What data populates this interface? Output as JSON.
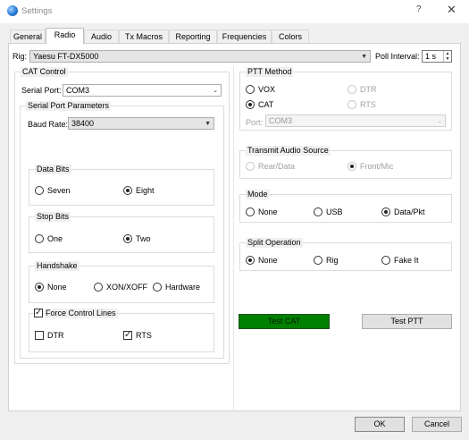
{
  "window": {
    "title": "Settings",
    "help_glyph": "?",
    "close_glyph": "✕"
  },
  "tabs": [
    {
      "label": "General"
    },
    {
      "label": "Radio"
    },
    {
      "label": "Audio"
    },
    {
      "label": "Tx Macros"
    },
    {
      "label": "Reporting"
    },
    {
      "label": "Frequencies"
    },
    {
      "label": "Colors"
    }
  ],
  "active_tab": "Radio",
  "rig": {
    "label": "Rig:",
    "value": "Yaesu FT-DX5000"
  },
  "poll_interval": {
    "label": "Poll Interval:",
    "value": "1 s"
  },
  "cat_control": {
    "title": "CAT Control",
    "serial_port": {
      "label": "Serial Port:",
      "value": "COM3"
    },
    "serial_params": {
      "title": "Serial Port Parameters",
      "baud_rate": {
        "label": "Baud Rate:",
        "value": "38400"
      },
      "data_bits": {
        "title": "Data Bits",
        "options": [
          "Seven",
          "Eight"
        ],
        "selected": "Eight"
      },
      "stop_bits": {
        "title": "Stop Bits",
        "options": [
          "One",
          "Two"
        ],
        "selected": "Two"
      },
      "handshake": {
        "title": "Handshake",
        "options": [
          "None",
          "XON/XOFF",
          "Hardware"
        ],
        "selected": "None"
      },
      "force_control_lines": {
        "label": "Force Control Lines",
        "checked": true,
        "dtr": {
          "label": "DTR",
          "checked": false
        },
        "rts": {
          "label": "RTS",
          "checked": true
        }
      }
    }
  },
  "ptt_method": {
    "title": "PTT Method",
    "options": [
      "VOX",
      "DTR",
      "CAT",
      "RTS"
    ],
    "selected": "CAT",
    "port": {
      "label": "Port:",
      "value": "COM3"
    }
  },
  "transmit_audio_source": {
    "title": "Transmit Audio Source",
    "options": [
      "Rear/Data",
      "Front/Mic"
    ],
    "selected": "Front/Mic"
  },
  "mode": {
    "title": "Mode",
    "options": [
      "None",
      "USB",
      "Data/Pkt"
    ],
    "selected": "Data/Pkt"
  },
  "split_operation": {
    "title": "Split Operation",
    "options": [
      "None",
      "Rig",
      "Fake It"
    ],
    "selected": "None"
  },
  "buttons": {
    "test_cat": "Test CAT",
    "test_ptt": "Test PTT",
    "ok": "OK",
    "cancel": "Cancel"
  },
  "colors": {
    "test_cat_bg": "#008000",
    "panel_bg": "#f0f0f0"
  }
}
